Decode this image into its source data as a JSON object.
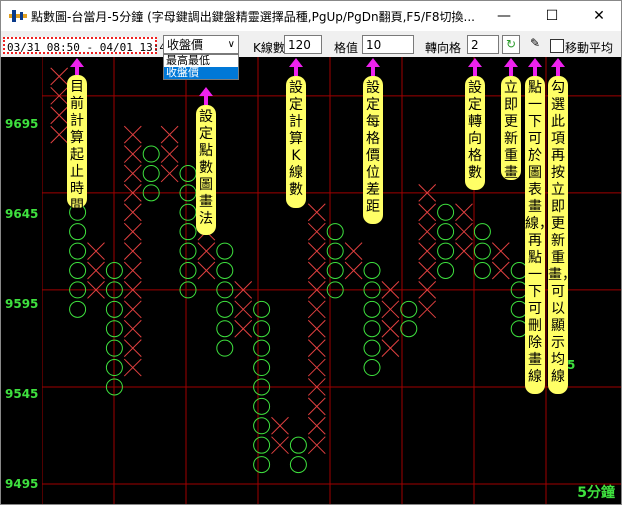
{
  "window": {
    "title": "點數圖-台當月-5分鐘 (字母鍵調出鍵盤精靈選擇品種,PgUp/PgDn翻頁,F5/F8切換...",
    "minimize": "—",
    "maximize": "☐",
    "close": "✕"
  },
  "toolbar": {
    "time_range": "03/31 08:50 - 04/01 13:45",
    "method_selected": "收盤價",
    "method_options": [
      "最高最低",
      "收盤價"
    ],
    "k_count_label": "K線數",
    "k_count_value": "120",
    "box_value_label": "格值",
    "box_value": "10",
    "reversal_label": "轉向格",
    "reversal_value": "2",
    "moving_avg_label": "移動平均",
    "moving_avg_checked": false
  },
  "chart": {
    "y_ticks": [
      "9695",
      "9645",
      "9595",
      "9545",
      "9495"
    ],
    "period_label": "5分鐘",
    "side_number": "5",
    "colors": {
      "x_mark": "#e04040",
      "o_mark": "#3ee03e",
      "grid": "#a00000",
      "background": "#000000"
    }
  },
  "chart_data": {
    "type": "point-and-figure",
    "box_size": 10,
    "reversal": 2,
    "ylim": [
      9495,
      9715
    ],
    "columns": [
      {
        "type": "X",
        "low": 9675,
        "high": 9705
      },
      {
        "type": "O",
        "low": 9585,
        "high": 9655
      },
      {
        "type": "X",
        "low": 9595,
        "high": 9615
      },
      {
        "type": "O",
        "low": 9545,
        "high": 9605
      },
      {
        "type": "X",
        "low": 9555,
        "high": 9675
      },
      {
        "type": "O",
        "low": 9645,
        "high": 9665
      },
      {
        "type": "X",
        "low": 9655,
        "high": 9675
      },
      {
        "type": "O",
        "low": 9595,
        "high": 9655
      },
      {
        "type": "X",
        "low": 9605,
        "high": 9625
      },
      {
        "type": "O",
        "low": 9565,
        "high": 9615
      },
      {
        "type": "X",
        "low": 9575,
        "high": 9595
      },
      {
        "type": "O",
        "low": 9505,
        "high": 9585
      },
      {
        "type": "X",
        "low": 9515,
        "high": 9525
      },
      {
        "type": "O",
        "low": 9505,
        "high": 9515
      },
      {
        "type": "X",
        "low": 9515,
        "high": 9635
      },
      {
        "type": "O",
        "low": 9595,
        "high": 9625
      },
      {
        "type": "X",
        "low": 9605,
        "high": 9615
      },
      {
        "type": "O",
        "low": 9555,
        "high": 9605
      },
      {
        "type": "X",
        "low": 9565,
        "high": 9595
      },
      {
        "type": "O",
        "low": 9575,
        "high": 9585
      },
      {
        "type": "X",
        "low": 9585,
        "high": 9645
      },
      {
        "type": "O",
        "low": 9605,
        "high": 9635
      },
      {
        "type": "X",
        "low": 9615,
        "high": 9635
      },
      {
        "type": "O",
        "low": 9605,
        "high": 9625
      },
      {
        "type": "X",
        "low": 9605,
        "high": 9615
      },
      {
        "type": "O",
        "low": 9575,
        "high": 9605
      }
    ]
  },
  "callouts": [
    {
      "name": "callout-time-range",
      "text": "目前計算起止時間"
    },
    {
      "name": "callout-method",
      "text": "設定點數圖畫法"
    },
    {
      "name": "callout-k-count",
      "text": "設定計算K線數"
    },
    {
      "name": "callout-box-value",
      "text": "設定每格價位差距"
    },
    {
      "name": "callout-reversal",
      "text": "設定轉向格數"
    },
    {
      "name": "callout-refresh",
      "text": "立即更新重畫"
    },
    {
      "name": "callout-draw",
      "text": "點一下可於圖表畫線，再點一下可刪除畫線"
    },
    {
      "name": "callout-moving-avg",
      "text": "勾選此項再按立即更新重畫，可以顯示均線"
    }
  ]
}
